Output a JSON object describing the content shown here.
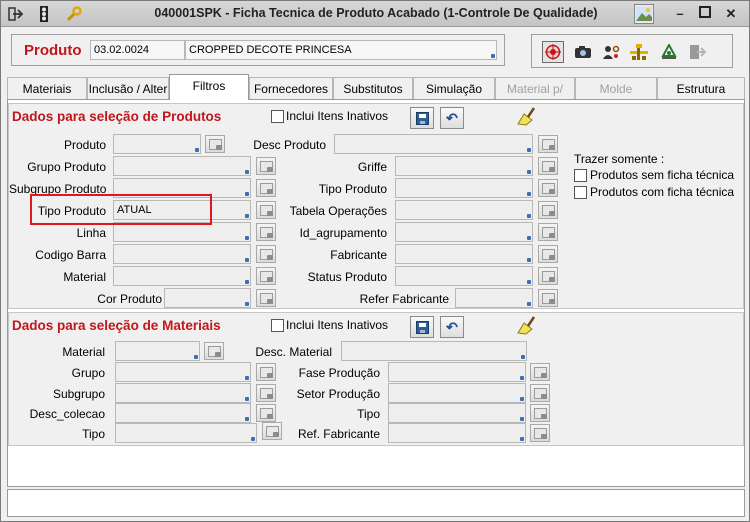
{
  "window": {
    "title": "040001SPK - Ficha Tecnica de Produto Acabado (1-Controle De Qualidade)",
    "icons": [
      "arrow-right-icon",
      "traffic-light-icon",
      "wrench-icon"
    ],
    "controls": [
      "image-icon",
      "minimize",
      "maximize",
      "close"
    ]
  },
  "header": {
    "produto_label": "Produto",
    "produto_code": "03.02.0024",
    "produto_desc": "CROPPED DECOTE PRINCESA"
  },
  "toolbar": {
    "icons": [
      "target-icon",
      "camera-icon",
      "user-cog-icon",
      "flowchart-icon",
      "recycle-icon",
      "exit-icon"
    ]
  },
  "tabs": [
    {
      "label": "Materiais"
    },
    {
      "label": "Inclusão / Alter"
    },
    {
      "label": "Filtros"
    },
    {
      "label": "Fornecedores"
    },
    {
      "label": "Substitutos"
    },
    {
      "label": "Simulação"
    },
    {
      "label": "Material p/ Tam"
    },
    {
      "label": "Molde"
    },
    {
      "label": "Estrutura"
    }
  ],
  "produtos": {
    "title": "Dados para seleção de Produtos",
    "inclui_inativos": "Inclui Itens Inativos",
    "left": [
      {
        "label": "Produto",
        "value": ""
      },
      {
        "label": "Grupo Produto",
        "value": ""
      },
      {
        "label": "Subgrupo Produto",
        "value": ""
      },
      {
        "label": "Tipo Produto",
        "value": "ATUAL"
      },
      {
        "label": "Linha",
        "value": ""
      },
      {
        "label": "Codigo Barra",
        "value": ""
      },
      {
        "label": "Material",
        "value": ""
      },
      {
        "label": "Cor Produto",
        "value": ""
      }
    ],
    "right": [
      {
        "label": "Desc Produto",
        "value": ""
      },
      {
        "label": "Griffe",
        "value": ""
      },
      {
        "label": "Tipo Produto",
        "value": ""
      },
      {
        "label": "Tabela Operações",
        "value": ""
      },
      {
        "label": "Id_agrupamento",
        "value": ""
      },
      {
        "label": "Fabricante",
        "value": ""
      },
      {
        "label": "Status Produto",
        "value": ""
      },
      {
        "label": "Refer Fabricante",
        "value": ""
      }
    ],
    "trazer": {
      "title": "Trazer somente :",
      "options": [
        "Produtos sem ficha técnica",
        "Produtos com ficha técnica"
      ]
    }
  },
  "materiais": {
    "title": "Dados para seleção de Materiais",
    "inclui_inativos": "Inclui Itens Inativos",
    "left": [
      {
        "label": "Material",
        "value": ""
      },
      {
        "label": "Grupo",
        "value": ""
      },
      {
        "label": "Subgrupo",
        "value": ""
      },
      {
        "label": "Desc_colecao",
        "value": ""
      },
      {
        "label": "Tipo",
        "value": ""
      }
    ],
    "right": [
      {
        "label": "Desc. Material",
        "value": ""
      },
      {
        "label": "Fase Produção",
        "value": ""
      },
      {
        "label": "Setor Produção",
        "value": ""
      },
      {
        "label": "Tipo",
        "value": ""
      },
      {
        "label": "Ref. Fabricante",
        "value": ""
      }
    ]
  }
}
